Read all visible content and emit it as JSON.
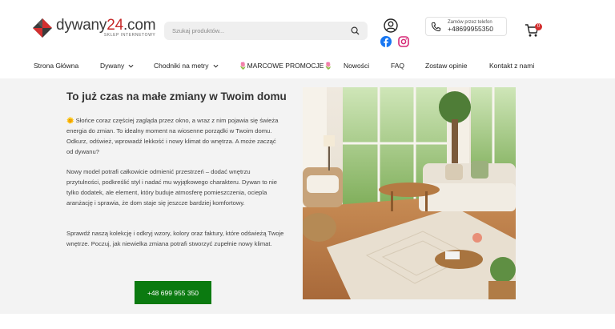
{
  "header": {
    "logo": {
      "name_main": "dywany",
      "name_num": "24",
      "name_tld": ".com",
      "tagline": "SKLEP INTERNETOWY"
    },
    "search": {
      "placeholder": "Szukaj produktów..."
    },
    "phone": {
      "label": "Zamów przez telefon",
      "number": "+48699955350"
    },
    "cart": {
      "count": "0"
    }
  },
  "nav": {
    "items": [
      {
        "label": "Strona Główna"
      },
      {
        "label": "Dywany"
      },
      {
        "label": "Chodniki na metry"
      },
      {
        "label": "🌷MARCOWE PROMOCJE🌷"
      },
      {
        "label": "Nowości"
      },
      {
        "label": "FAQ"
      },
      {
        "label": "Zostaw opinie"
      },
      {
        "label": "Kontakt z nami"
      }
    ]
  },
  "main": {
    "headline": "To już czas na małe zmiany w Twoim domu",
    "paragraphs": [
      {
        "icon": "🌞",
        "text": "Słońce coraz częściej zagląda przez okno, a wraz z nim pojawia się świeża energia do zmian. To idealny moment na wiosenne porządki w Twoim domu. Odkurz, odśwież, wprowadź lekkość i nowy klimat do wnętrza. A może zacząć od dywanu?"
      },
      {
        "text": "Nowy model potrafi całkowicie odmienić przestrzeń – dodać wnętrzu przytulności, podkreślić styl i nadać mu wyjątkowego charakteru. Dywan to nie tylko dodatek, ale element, który buduje atmosferę pomieszczenia, ociepla aranżację i sprawia, że dom staje się jeszcze bardziej komfortowy."
      },
      {
        "text": "Sprawdź naszą kolekcję i odkryj wzory, kolory oraz faktury, które odświeżą Twoje wnętrze. Poczuj, jak niewielka zmiana potrafi stworzyć zupełnie nowy klimat."
      }
    ],
    "cta_label": "+48 699 955 350"
  },
  "colors": {
    "accent_red": "#c62828",
    "cta_green": "#0b7a10",
    "band_bg": "#f3f3f3"
  },
  "icons": [
    "logo-diamond-icon",
    "search-icon",
    "user-icon",
    "facebook-icon",
    "instagram-icon",
    "phone-icon",
    "cart-icon",
    "chevron-down-icon"
  ]
}
